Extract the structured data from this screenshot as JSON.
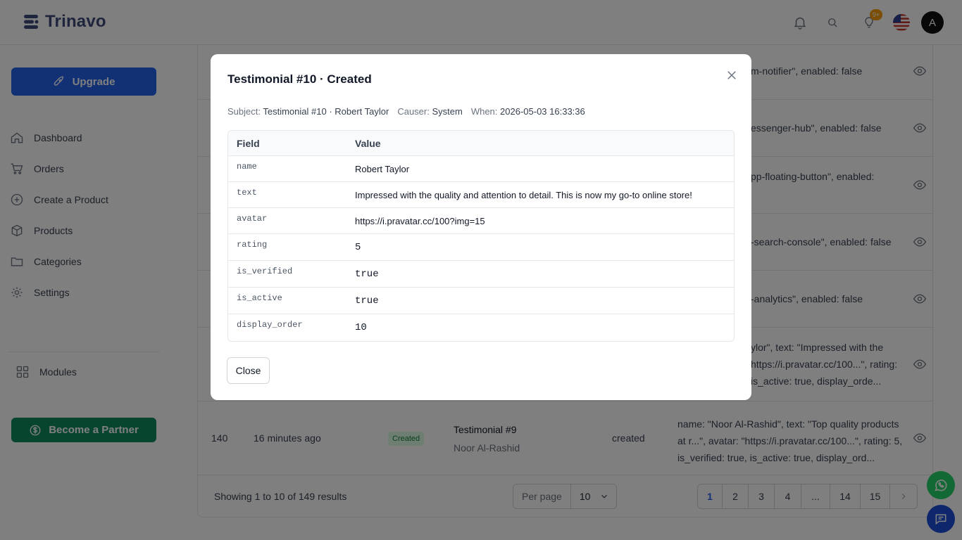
{
  "app": {
    "name": "Trinavo"
  },
  "header": {
    "notif_badge": "9+",
    "avatar_initial": "A"
  },
  "sidebar": {
    "upgrade_label": "Upgrade",
    "items": [
      {
        "label": "Dashboard",
        "icon": "home-icon"
      },
      {
        "label": "Orders",
        "icon": "cart-icon"
      },
      {
        "label": "Create a Product",
        "icon": "plus-circle-icon"
      },
      {
        "label": "Products",
        "icon": "box-icon"
      },
      {
        "label": "Categories",
        "icon": "folder-icon"
      },
      {
        "label": "Settings",
        "icon": "gear-icon"
      }
    ],
    "modules_label": "Modules",
    "partner_label": "Become a Partner"
  },
  "background": {
    "snippets": [
      "m-notifier\", enabled: false",
      "essenger-hub\", enabled: false",
      "pp-floating-button\", enabled:",
      "-search-console\", enabled: false",
      "-analytics\", enabled: false"
    ],
    "snippet6": [
      "ylor\", text: \"Impressed with the",
      "https://i.pravatar.cc/100...\", rating:",
      "is_active: true, display_orde..."
    ],
    "row140": {
      "id": "140",
      "time": "16 minutes ago",
      "status": "Created",
      "subject": "Testimonial #9",
      "subject_sub": "Noor Al-Rashid",
      "event": "created",
      "props": [
        "name: \"Noor Al-Rashid\", text: \"Top quality products",
        "at r...\", avatar: \"https://i.pravatar.cc/100...\", rating: 5,",
        "is_verified: true, is_active: true, display_ord..."
      ]
    },
    "footer": {
      "showing": "Showing 1 to 10 of 149 results",
      "per_page_label": "Per page",
      "per_page_value": "10",
      "pages": [
        "1",
        "2",
        "3",
        "4",
        "...",
        "14",
        "15"
      ]
    }
  },
  "modal": {
    "title": "Testimonial #10 · Created",
    "subject_label": "Subject:",
    "subject_value": "Testimonial #10 · Robert Taylor",
    "causer_label": "Causer:",
    "causer_value": "System",
    "when_label": "When:",
    "when_value": "2026-05-03 16:33:36",
    "col_field": "Field",
    "col_value": "Value",
    "rows": [
      {
        "field": "name",
        "value": "Robert Taylor"
      },
      {
        "field": "text",
        "value": "Impressed with the quality and attention to detail. This is now my go-to online store!"
      },
      {
        "field": "avatar",
        "value": "https://i.pravatar.cc/100?img=15"
      },
      {
        "field": "rating",
        "value": "5"
      },
      {
        "field": "is_verified",
        "value": "true"
      },
      {
        "field": "is_active",
        "value": "true"
      },
      {
        "field": "display_order",
        "value": "10"
      }
    ],
    "close_label": "Close"
  },
  "colors": {
    "primary": "#2563eb",
    "partner": "#0f8a5f",
    "whatsapp": "#25d366",
    "chat": "#1d4ed8"
  }
}
